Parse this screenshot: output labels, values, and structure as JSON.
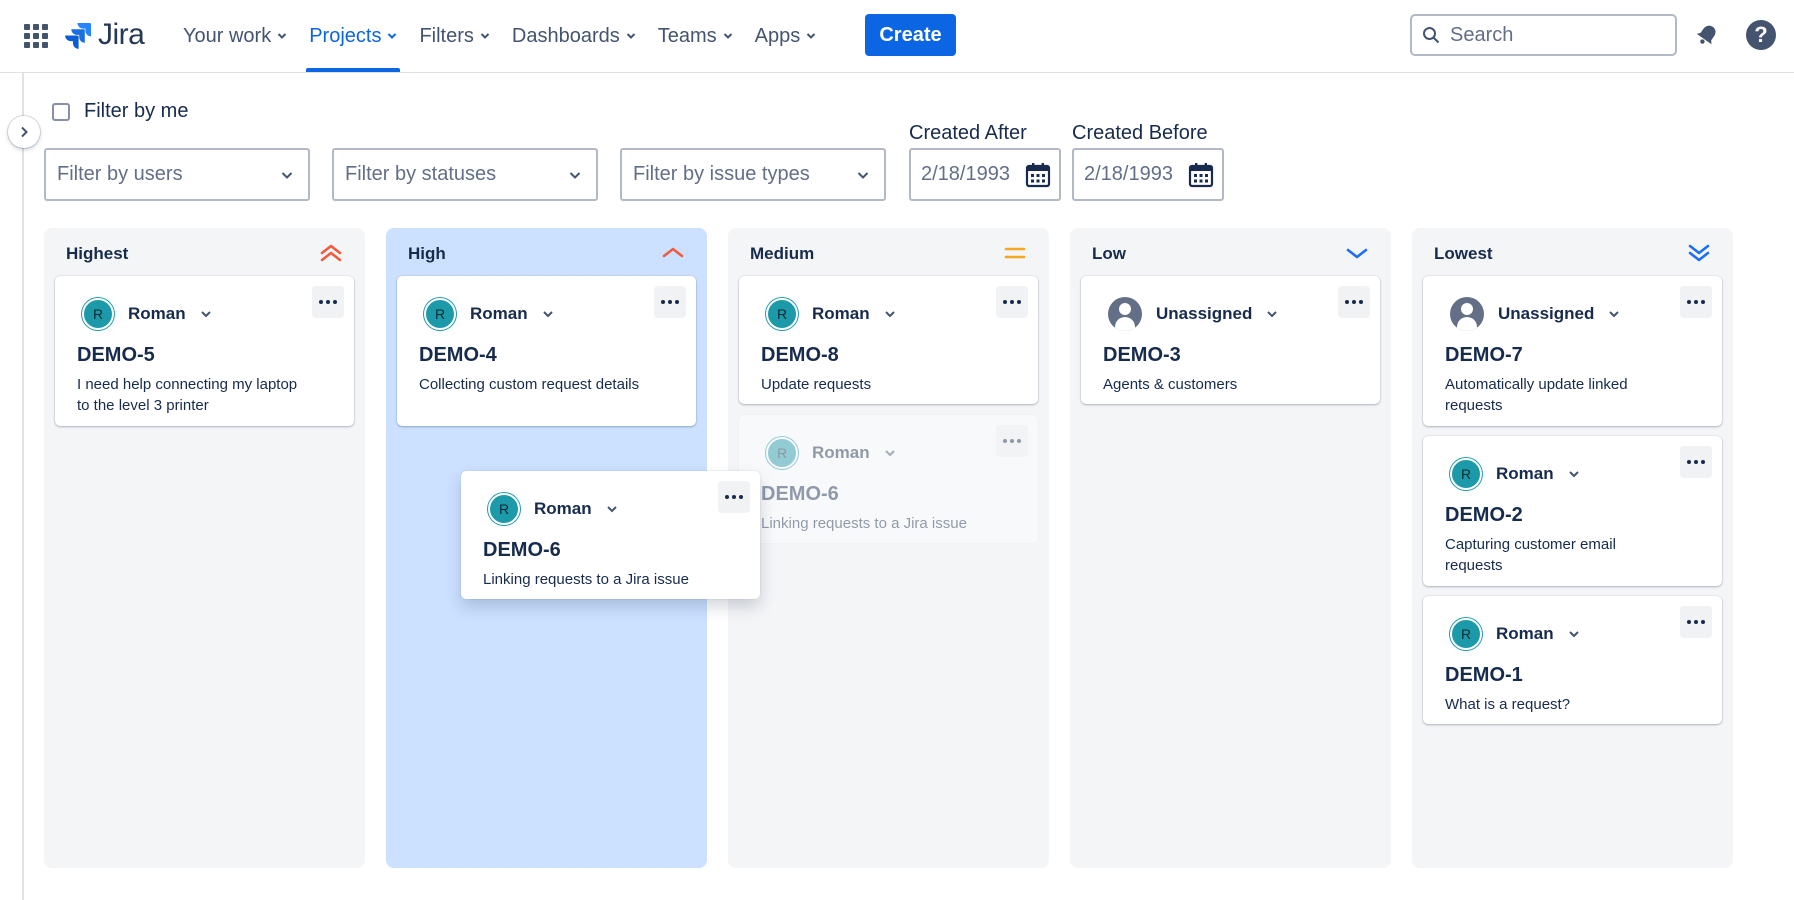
{
  "nav": {
    "logo_text": "Jira",
    "items": [
      {
        "label": "Your work",
        "active": false
      },
      {
        "label": "Projects",
        "active": true
      },
      {
        "label": "Filters",
        "active": false
      },
      {
        "label": "Dashboards",
        "active": false
      },
      {
        "label": "Teams",
        "active": false
      },
      {
        "label": "Apps",
        "active": false
      }
    ],
    "create_label": "Create",
    "search_placeholder": "Search",
    "help_glyph": "?"
  },
  "filters": {
    "filter_by_me_label": "Filter by me",
    "filter_by_me_checked": false,
    "users_placeholder": "Filter by users",
    "statuses_placeholder": "Filter by statuses",
    "issue_types_placeholder": "Filter by issue types",
    "created_after_label": "Created After",
    "created_after_value": "2/18/1993",
    "created_before_label": "Created Before",
    "created_before_value": "2/18/1993"
  },
  "colors": {
    "accent": "#0c66e4",
    "drop_target": "#cce0ff",
    "priority_highest": "#f15b3d",
    "priority_medium": "#f5a623",
    "priority_low": "#1d6ef2"
  },
  "columns": [
    {
      "title": "Highest",
      "icon": "priority-highest-icon",
      "cards": [
        {
          "assignee": "Roman",
          "initial": "R",
          "key": "DEMO-5",
          "summary": "I need help connecting my laptop to the level 3 printer"
        }
      ]
    },
    {
      "title": "High",
      "icon": "priority-high-icon",
      "cards": [
        {
          "assignee": "Roman",
          "initial": "R",
          "key": "DEMO-4",
          "summary": "Collecting custom request details"
        }
      ]
    },
    {
      "title": "Medium",
      "icon": "priority-medium-icon",
      "cards": [
        {
          "assignee": "Roman",
          "initial": "R",
          "key": "DEMO-8",
          "summary": "Update requests"
        },
        {
          "assignee": "Roman",
          "initial": "R",
          "key": "DEMO-6",
          "summary": "Linking requests to a Jira issue"
        }
      ]
    },
    {
      "title": "Low",
      "icon": "priority-low-icon",
      "cards": [
        {
          "assignee": "Unassigned",
          "key": "DEMO-3",
          "summary": "Agents & customers"
        }
      ]
    },
    {
      "title": "Lowest",
      "icon": "priority-lowest-icon",
      "cards": [
        {
          "assignee": "Unassigned",
          "key": "DEMO-7",
          "summary": "Automatically update linked requests"
        },
        {
          "assignee": "Roman",
          "initial": "R",
          "key": "DEMO-2",
          "summary": "Capturing customer email requests"
        },
        {
          "assignee": "Roman",
          "initial": "R",
          "key": "DEMO-1",
          "summary": "What is a request?"
        }
      ]
    }
  ],
  "dragging_card": {
    "assignee": "Roman",
    "initial": "R",
    "key": "DEMO-6",
    "summary": "Linking requests to a Jira issue"
  }
}
